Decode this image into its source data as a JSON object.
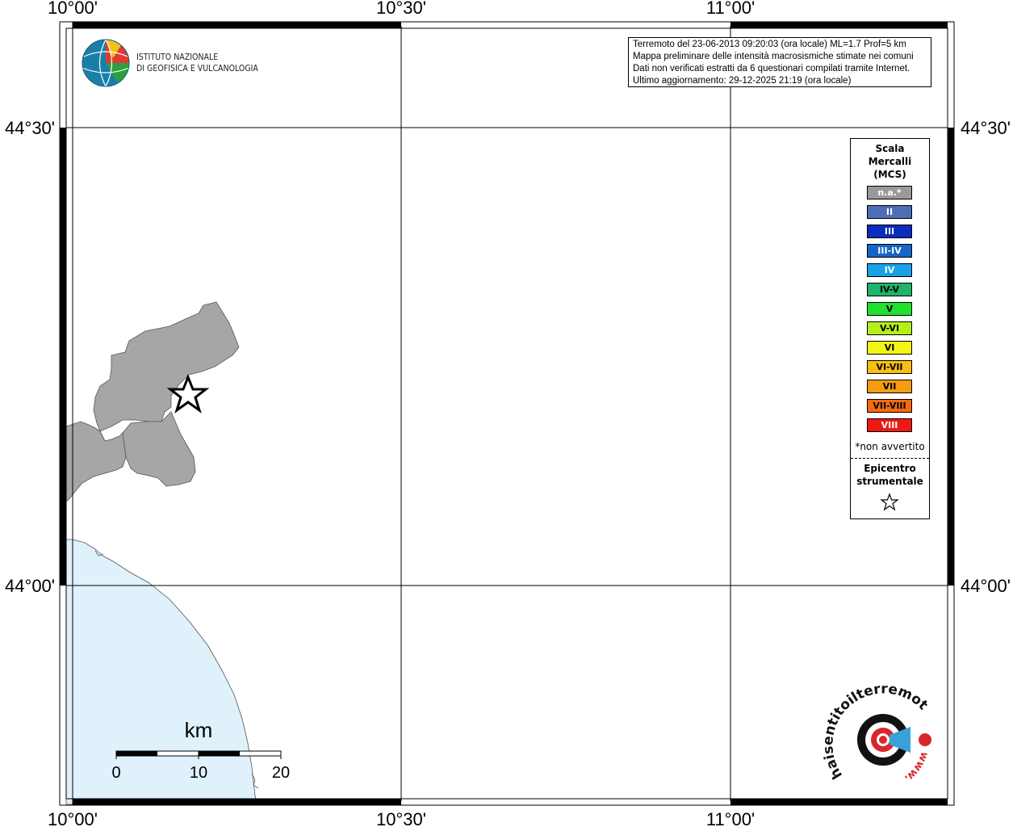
{
  "map": {
    "lon_labels": [
      "10°00'",
      "10°30'",
      "11°00'"
    ],
    "lat_labels": [
      "44°30'",
      "44°00'"
    ]
  },
  "info": {
    "line1": "Terremoto del 23-06-2013 09:20:03 (ora locale) ML=1.7 Prof=5 km",
    "line2": "Mappa preliminare delle intensità macrosismiche stimate nei comuni",
    "line3": "Dati non verificati estratti da 6 questionari compilati tramite Internet.",
    "line4": "Ultimo aggiornamento: 29-12-2025 21:19 (ora locale)"
  },
  "ingv": {
    "line1": "ISTITUTO NAZIONALE",
    "line2": "DI GEOFISICA E VULCANOLOGIA"
  },
  "legend": {
    "title1": "Scala",
    "title2": "Mercalli",
    "title3": "(MCS)",
    "items": [
      {
        "label": "n.a.*",
        "color": "#9a9a9a",
        "text": "#ffffff"
      },
      {
        "label": "II",
        "color": "#4e6db4",
        "text": "#ffffff"
      },
      {
        "label": "III",
        "color": "#0a2cbf",
        "text": "#ffffff"
      },
      {
        "label": "III-IV",
        "color": "#1565c8",
        "text": "#ffffff"
      },
      {
        "label": "IV",
        "color": "#19a0e6",
        "text": "#ffffff"
      },
      {
        "label": "IV-V",
        "color": "#1db36a",
        "text": "#000000"
      },
      {
        "label": "V",
        "color": "#22e02e",
        "text": "#000000"
      },
      {
        "label": "V-VI",
        "color": "#b5ef1a",
        "text": "#000000"
      },
      {
        "label": "VI",
        "color": "#f5f514",
        "text": "#000000"
      },
      {
        "label": "VI-VII",
        "color": "#f7bf12",
        "text": "#000000"
      },
      {
        "label": "VII",
        "color": "#f59d12",
        "text": "#000000"
      },
      {
        "label": "VII-VIII",
        "color": "#f26a12",
        "text": "#000000"
      },
      {
        "label": "VIII",
        "color": "#ee1a12",
        "text": "#ffffff"
      }
    ],
    "note": "*non avvertito",
    "epi1": "Epicentro",
    "epi2": "strumentale"
  },
  "scalebar": {
    "unit": "km",
    "ticks": [
      "0",
      "10",
      "20"
    ]
  },
  "hsit_logo": {
    "text": "haisentitoilterremoto.it",
    "www": "www."
  },
  "colors": {
    "land": "#a6a6a6",
    "sea": "#dff1fb",
    "frame": "#000000"
  }
}
